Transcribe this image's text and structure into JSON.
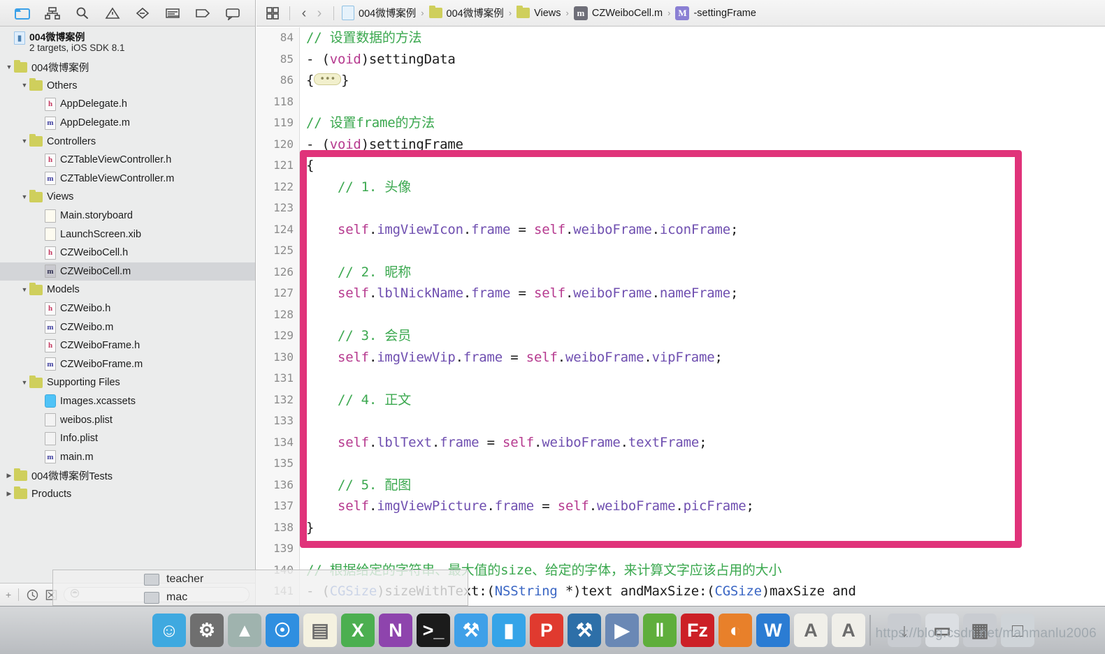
{
  "navigator": {
    "tabs": [
      {
        "name": "folder-icon",
        "title": "Project navigator",
        "active": true
      },
      {
        "name": "hierarchy-icon",
        "title": "Symbol navigator",
        "active": false
      },
      {
        "name": "search-icon",
        "title": "Find navigator",
        "active": false
      },
      {
        "name": "warning-triangle-icon",
        "title": "Issue navigator",
        "active": false
      },
      {
        "name": "diamond-icon",
        "title": "Test navigator",
        "active": false
      },
      {
        "name": "list-icon",
        "title": "Debug navigator",
        "active": false
      },
      {
        "name": "tag-icon",
        "title": "Breakpoint navigator",
        "active": false
      },
      {
        "name": "speech-bubble-icon",
        "title": "Report navigator",
        "active": false
      }
    ],
    "project": {
      "name": "004微博案例",
      "subtitle": "2 targets, iOS SDK 8.1"
    },
    "tree": [
      {
        "label": "004微博案例",
        "indent": 0,
        "disc": "down",
        "icon": "folder",
        "selected": false
      },
      {
        "label": "Others",
        "indent": 1,
        "disc": "down",
        "icon": "folder",
        "selected": false
      },
      {
        "label": "AppDelegate.h",
        "indent": 2,
        "disc": "",
        "icon": "h",
        "selected": false
      },
      {
        "label": "AppDelegate.m",
        "indent": 2,
        "disc": "",
        "icon": "m",
        "selected": false
      },
      {
        "label": "Controllers",
        "indent": 1,
        "disc": "down",
        "icon": "folder",
        "selected": false
      },
      {
        "label": "CZTableViewController.h",
        "indent": 2,
        "disc": "",
        "icon": "h",
        "selected": false
      },
      {
        "label": "CZTableViewController.m",
        "indent": 2,
        "disc": "",
        "icon": "m",
        "selected": false
      },
      {
        "label": "Views",
        "indent": 1,
        "disc": "down",
        "icon": "folder",
        "selected": false
      },
      {
        "label": "Main.storyboard",
        "indent": 2,
        "disc": "",
        "icon": "sb",
        "selected": false
      },
      {
        "label": "LaunchScreen.xib",
        "indent": 2,
        "disc": "",
        "icon": "sb",
        "selected": false
      },
      {
        "label": "CZWeiboCell.h",
        "indent": 2,
        "disc": "",
        "icon": "h",
        "selected": false
      },
      {
        "label": "CZWeiboCell.m",
        "indent": 2,
        "disc": "",
        "icon": "m-sel",
        "selected": true
      },
      {
        "label": "Models",
        "indent": 1,
        "disc": "down",
        "icon": "folder",
        "selected": false
      },
      {
        "label": "CZWeibo.h",
        "indent": 2,
        "disc": "",
        "icon": "h",
        "selected": false
      },
      {
        "label": "CZWeibo.m",
        "indent": 2,
        "disc": "",
        "icon": "m",
        "selected": false
      },
      {
        "label": "CZWeiboFrame.h",
        "indent": 2,
        "disc": "",
        "icon": "h",
        "selected": false
      },
      {
        "label": "CZWeiboFrame.m",
        "indent": 2,
        "disc": "",
        "icon": "m",
        "selected": false
      },
      {
        "label": "Supporting Files",
        "indent": 1,
        "disc": "down",
        "icon": "folder",
        "selected": false
      },
      {
        "label": "Images.xcassets",
        "indent": 2,
        "disc": "",
        "icon": "xc",
        "selected": false
      },
      {
        "label": "weibos.plist",
        "indent": 2,
        "disc": "",
        "icon": "plain",
        "selected": false
      },
      {
        "label": "Info.plist",
        "indent": 2,
        "disc": "",
        "icon": "plain",
        "selected": false
      },
      {
        "label": "main.m",
        "indent": 2,
        "disc": "",
        "icon": "m",
        "selected": false
      },
      {
        "label": "004微博案例Tests",
        "indent": 0,
        "disc": "right",
        "icon": "folder",
        "selected": false
      },
      {
        "label": "Products",
        "indent": 0,
        "disc": "right",
        "icon": "folder",
        "selected": false
      }
    ],
    "bottom_bar": {
      "clock_icon": "clock-icon",
      "nesting_icon": "nesting-icon",
      "filter_placeholder": "",
      "filter_value": ""
    }
  },
  "jumpbar": {
    "grid_icon": "grid-icon",
    "back_label": "‹",
    "forward_label": "›",
    "crumbs": [
      {
        "label": "004微博案例",
        "icon": "project-doc-icon"
      },
      {
        "label": "004微博案例",
        "icon": "folder-icon"
      },
      {
        "label": "Views",
        "icon": "folder-icon"
      },
      {
        "label": "CZWeiboCell.m",
        "icon": "m-file-icon"
      },
      {
        "label": "-settingFrame",
        "icon": "method-symbol-icon"
      }
    ],
    "separator": "›"
  },
  "editor": {
    "lines": [
      {
        "num": "84",
        "tokens": [
          {
            "t": "// 设置数据的方法",
            "c": "cmt"
          }
        ]
      },
      {
        "num": "85",
        "tokens": [
          {
            "t": "- (",
            "c": "plain"
          },
          {
            "t": "void",
            "c": "kw"
          },
          {
            "t": ")settingData",
            "c": "plain"
          }
        ]
      },
      {
        "num": "86",
        "tokens": [
          {
            "t": "{",
            "c": "plain"
          },
          {
            "t": "FOLD",
            "c": "fold"
          },
          {
            "t": "}",
            "c": "plain"
          }
        ]
      },
      {
        "num": "118",
        "tokens": []
      },
      {
        "num": "119",
        "tokens": [
          {
            "t": "// 设置frame的方法",
            "c": "cmt"
          }
        ]
      },
      {
        "num": "120",
        "tokens": [
          {
            "t": "- (",
            "c": "plain"
          },
          {
            "t": "void",
            "c": "kw"
          },
          {
            "t": ")settingFrame",
            "c": "plain"
          }
        ]
      },
      {
        "num": "121",
        "tokens": [
          {
            "t": "{",
            "c": "plain"
          }
        ]
      },
      {
        "num": "122",
        "tokens": [
          {
            "t": "    // 1. 头像",
            "c": "cmt"
          }
        ]
      },
      {
        "num": "123",
        "tokens": []
      },
      {
        "num": "124",
        "tokens": [
          {
            "t": "    ",
            "c": "plain"
          },
          {
            "t": "self",
            "c": "kw"
          },
          {
            "t": ".",
            "c": "plain"
          },
          {
            "t": "imgViewIcon",
            "c": "prop"
          },
          {
            "t": ".",
            "c": "plain"
          },
          {
            "t": "frame",
            "c": "prop"
          },
          {
            "t": " = ",
            "c": "plain"
          },
          {
            "t": "self",
            "c": "kw"
          },
          {
            "t": ".",
            "c": "plain"
          },
          {
            "t": "weiboFrame",
            "c": "prop"
          },
          {
            "t": ".",
            "c": "plain"
          },
          {
            "t": "iconFrame",
            "c": "prop"
          },
          {
            "t": ";",
            "c": "plain"
          }
        ]
      },
      {
        "num": "125",
        "tokens": []
      },
      {
        "num": "126",
        "tokens": [
          {
            "t": "    // 2. 昵称",
            "c": "cmt"
          }
        ]
      },
      {
        "num": "127",
        "tokens": [
          {
            "t": "    ",
            "c": "plain"
          },
          {
            "t": "self",
            "c": "kw"
          },
          {
            "t": ".",
            "c": "plain"
          },
          {
            "t": "lblNickName",
            "c": "prop"
          },
          {
            "t": ".",
            "c": "plain"
          },
          {
            "t": "frame",
            "c": "prop"
          },
          {
            "t": " = ",
            "c": "plain"
          },
          {
            "t": "self",
            "c": "kw"
          },
          {
            "t": ".",
            "c": "plain"
          },
          {
            "t": "weiboFrame",
            "c": "prop"
          },
          {
            "t": ".",
            "c": "plain"
          },
          {
            "t": "nameFrame",
            "c": "prop"
          },
          {
            "t": ";",
            "c": "plain"
          }
        ]
      },
      {
        "num": "128",
        "tokens": []
      },
      {
        "num": "129",
        "tokens": [
          {
            "t": "    // 3. 会员",
            "c": "cmt"
          }
        ]
      },
      {
        "num": "130",
        "tokens": [
          {
            "t": "    ",
            "c": "plain"
          },
          {
            "t": "self",
            "c": "kw"
          },
          {
            "t": ".",
            "c": "plain"
          },
          {
            "t": "imgViewVip",
            "c": "prop"
          },
          {
            "t": ".",
            "c": "plain"
          },
          {
            "t": "frame",
            "c": "prop"
          },
          {
            "t": " = ",
            "c": "plain"
          },
          {
            "t": "self",
            "c": "kw"
          },
          {
            "t": ".",
            "c": "plain"
          },
          {
            "t": "weiboFrame",
            "c": "prop"
          },
          {
            "t": ".",
            "c": "plain"
          },
          {
            "t": "vipFrame",
            "c": "prop"
          },
          {
            "t": ";",
            "c": "plain"
          }
        ]
      },
      {
        "num": "131",
        "tokens": []
      },
      {
        "num": "132",
        "tokens": [
          {
            "t": "    // 4. 正文",
            "c": "cmt"
          }
        ]
      },
      {
        "num": "133",
        "tokens": []
      },
      {
        "num": "134",
        "tokens": [
          {
            "t": "    ",
            "c": "plain"
          },
          {
            "t": "self",
            "c": "kw"
          },
          {
            "t": ".",
            "c": "plain"
          },
          {
            "t": "lblText",
            "c": "prop"
          },
          {
            "t": ".",
            "c": "plain"
          },
          {
            "t": "frame",
            "c": "prop"
          },
          {
            "t": " = ",
            "c": "plain"
          },
          {
            "t": "self",
            "c": "kw"
          },
          {
            "t": ".",
            "c": "plain"
          },
          {
            "t": "weiboFrame",
            "c": "prop"
          },
          {
            "t": ".",
            "c": "plain"
          },
          {
            "t": "textFrame",
            "c": "prop"
          },
          {
            "t": ";",
            "c": "plain"
          }
        ]
      },
      {
        "num": "135",
        "tokens": []
      },
      {
        "num": "136",
        "tokens": [
          {
            "t": "    // 5. 配图",
            "c": "cmt"
          }
        ]
      },
      {
        "num": "137",
        "tokens": [
          {
            "t": "    ",
            "c": "plain"
          },
          {
            "t": "self",
            "c": "kw"
          },
          {
            "t": ".",
            "c": "plain"
          },
          {
            "t": "imgViewPicture",
            "c": "prop"
          },
          {
            "t": ".",
            "c": "plain"
          },
          {
            "t": "frame",
            "c": "prop"
          },
          {
            "t": " = ",
            "c": "plain"
          },
          {
            "t": "self",
            "c": "kw"
          },
          {
            "t": ".",
            "c": "plain"
          },
          {
            "t": "weiboFrame",
            "c": "prop"
          },
          {
            "t": ".",
            "c": "plain"
          },
          {
            "t": "picFrame",
            "c": "prop"
          },
          {
            "t": ";",
            "c": "plain"
          }
        ]
      },
      {
        "num": "138",
        "tokens": [
          {
            "t": "}",
            "c": "plain"
          }
        ]
      },
      {
        "num": "139",
        "tokens": []
      },
      {
        "num": "140",
        "tokens": [
          {
            "t": "// 根据给定的字符串、最大值的size、给定的字体，来计算文字应该占用的大小",
            "c": "cmt"
          }
        ]
      },
      {
        "num": "141",
        "tokens": [
          {
            "t": "- (",
            "c": "plain"
          },
          {
            "t": "CGSize",
            "c": "type"
          },
          {
            "t": ")sizeWithText:(",
            "c": "plain"
          },
          {
            "t": "NSString",
            "c": "type"
          },
          {
            "t": " *)text andMaxSize:(",
            "c": "plain"
          },
          {
            "t": "CGSize",
            "c": "type"
          },
          {
            "t": ")maxSize and",
            "c": "plain"
          }
        ]
      }
    ],
    "fold_placeholder": "•••",
    "highlight_color": "#e0337a"
  },
  "finder_window": {
    "rows": [
      {
        "label": "teacher"
      },
      {
        "label": "mac"
      }
    ]
  },
  "dock": {
    "items": [
      {
        "name": "finder-icon",
        "label": "Finder",
        "color": "#3fa9e0"
      },
      {
        "name": "system-preferences-icon",
        "label": "System Preferences",
        "color": "#6f6f6f"
      },
      {
        "name": "launchpad-icon",
        "label": "Launchpad",
        "color": "#9fb3ae"
      },
      {
        "name": "safari-icon",
        "label": "Safari",
        "color": "#2f8fe0"
      },
      {
        "name": "notes-icon",
        "label": "Notes",
        "color": "#f4f1e0"
      },
      {
        "name": "excel-icon",
        "label": "Excel",
        "color": "#4caf50"
      },
      {
        "name": "onenote-icon",
        "label": "OneNote",
        "color": "#8e44ad"
      },
      {
        "name": "terminal-icon",
        "label": "Terminal",
        "color": "#1b1b1b"
      },
      {
        "name": "xcode-icon",
        "label": "Xcode",
        "color": "#3fa0e8"
      },
      {
        "name": "ibooks-icon",
        "label": "iBooks",
        "color": "#35a4e8"
      },
      {
        "name": "keynote-icon",
        "label": "Keynote",
        "color": "#e03a2f"
      },
      {
        "name": "tools-icon",
        "label": "Utilities",
        "color": "#2d6fa8"
      },
      {
        "name": "media-player-icon",
        "label": "Media Player",
        "color": "#6a88b5"
      },
      {
        "name": "parallels-icon",
        "label": "Parallels",
        "color": "#5fae3c"
      },
      {
        "name": "filezilla-icon",
        "label": "FileZilla",
        "color": "#cc2026"
      },
      {
        "name": "firefox-icon",
        "label": "Firefox",
        "color": "#e8802a"
      },
      {
        "name": "word-icon",
        "label": "Word",
        "color": "#2b7cd3"
      },
      {
        "name": "fontbook-icon",
        "label": "Font Book",
        "color": "#f0efe9"
      },
      {
        "name": "fontbook2-icon",
        "label": "Font Book",
        "color": "#f0efe9"
      },
      {
        "name": "downloads-icon",
        "label": "Downloads",
        "color": "#c9ccd1"
      },
      {
        "name": "documents-icon",
        "label": "Documents",
        "color": "#dcdfe3"
      },
      {
        "name": "applications-icon",
        "label": "Applications",
        "color": "#c9ccd1"
      },
      {
        "name": "trash-icon",
        "label": "Trash",
        "color": "#cfd4d8"
      }
    ]
  },
  "watermark": {
    "text": "https://blog.csdn.net/manmanlu2006"
  }
}
